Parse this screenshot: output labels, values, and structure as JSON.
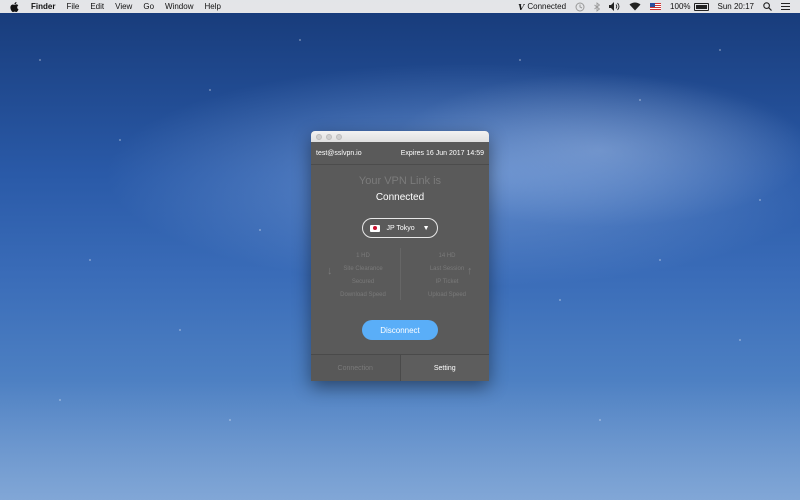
{
  "menubar": {
    "app_name": "Finder",
    "menus": [
      "File",
      "Edit",
      "View",
      "Go",
      "Window",
      "Help"
    ],
    "vpn_glyph": "V",
    "vpn_status": "Connected",
    "battery": "100%",
    "clock": "Sun 20:17",
    "icons": [
      "apple-icon",
      "time-machine-icon",
      "bluetooth-icon",
      "volume-icon",
      "wifi-icon",
      "us-flag-icon",
      "battery-icon",
      "spotlight-icon",
      "notification-list-icon"
    ]
  },
  "vpn_window": {
    "account": "test@sslvpn.io",
    "expires": "Expires 16 Jun 2017 14:59",
    "status_title": "Your VPN Link is",
    "status_value": "Connected",
    "location": "JP Tokyo",
    "download": {
      "line1": "1 HD",
      "line2": "Site Clearance",
      "line3": "Secured",
      "line4": "Download Speed"
    },
    "upload": {
      "line1": "14 HD",
      "line2": "Last Session",
      "line3": "IP Ticket",
      "line4": "Upload Speed"
    },
    "disconnect_label": "Disconnect",
    "tabs": {
      "connection": "Connection",
      "setting": "Setting"
    }
  }
}
